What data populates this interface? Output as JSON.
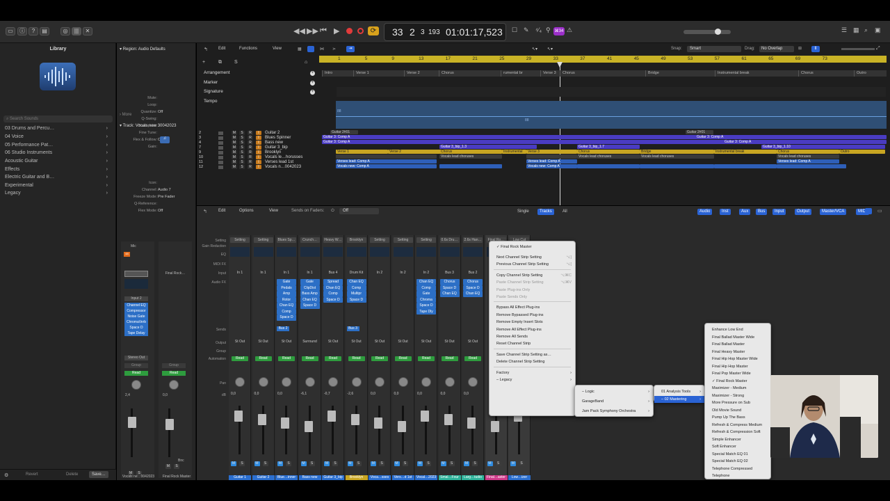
{
  "transport": {
    "bar": "33",
    "beat": "2",
    "div": "3",
    "tick": "193",
    "time": "01:01:17,523",
    "key_badge": "⌘34"
  },
  "library": {
    "title": "Library",
    "search_placeholder": "Search Sounds",
    "categories": [
      "03 Drums and Percu…",
      "04 Voice",
      "05 Performance Pat…",
      "06 Studio Instruments",
      "Acoustic Guitar",
      "Effects",
      "Electric Guitar and B…",
      "Experimental",
      "Legacy"
    ],
    "footer": {
      "revert": "Revert",
      "delete": "Delete",
      "save": "Save…"
    }
  },
  "inspector": {
    "region_header": "Region: Audio Defaults",
    "region_rows": [
      {
        "l": "Mute:",
        "v": ""
      },
      {
        "l": "Loop:",
        "v": ""
      },
      {
        "l": "Quantize:",
        "v": "Off"
      },
      {
        "l": "Q-Swing:",
        "v": ""
      },
      {
        "l": "Transpose:",
        "v": ""
      },
      {
        "l": "Fine Tune:",
        "v": ""
      },
      {
        "l": "Flex & Follow:",
        "v": "Off"
      },
      {
        "l": "Gain:",
        "v": ""
      }
    ],
    "more": "More",
    "track_header": "Track:  Vocals new 30042023",
    "track_rows": [
      {
        "l": "Icon:",
        "v": ""
      },
      {
        "l": "Channel:",
        "v": "Audio 7"
      },
      {
        "l": "Freeze Mode:",
        "v": "Pre Fader"
      },
      {
        "l": "Q-Reference:",
        "v": ""
      },
      {
        "l": "Flex Mode:",
        "v": "Off"
      }
    ],
    "strip1": {
      "mic": "Mic",
      "input": "Input 2",
      "plugins": [
        "Channel EQ",
        "Compressor",
        "Noise Gate",
        "ChromaVerb",
        "Space D",
        "Tape Delay"
      ],
      "output": "Stereo Out",
      "group": "Group",
      "read": "Read",
      "pan": "2,4",
      "vol": "0,0",
      "name": "Vocals ne…0042023"
    },
    "strip2": {
      "setting": "Final Rock…",
      "group": "Group",
      "read": "Read",
      "vol": "0,0",
      "bnc": "Bnc",
      "name": "Final Rock Master"
    }
  },
  "tracks_toolbar": {
    "edit": "Edit",
    "functions": "Functions",
    "view": "View",
    "snap_label": "Snap:",
    "snap": "Smart",
    "drag_label": "Drag:",
    "drag": "No Overlap"
  },
  "global_tracks": [
    "Arrangement",
    "Marker",
    "Signature",
    "Tempo"
  ],
  "ruler": [
    "1",
    "5",
    "9",
    "13",
    "17",
    "21",
    "25",
    "29",
    "33",
    "37",
    "41",
    "45",
    "49",
    "53",
    "57",
    "61",
    "65",
    "69",
    "73"
  ],
  "sections": [
    {
      "t": "Intro"
    },
    {
      "t": "Verse 1"
    },
    {
      "t": "Verse 2"
    },
    {
      "t": "Chorus"
    },
    {
      "t": "rumental br"
    },
    {
      "t": "Verse 3"
    },
    {
      "t": "Chorus"
    },
    {
      "t": "Bridge"
    },
    {
      "t": "Instrumental break"
    },
    {
      "t": "Chorus"
    },
    {
      "t": "Outro"
    }
  ],
  "tempo": {
    "a": "88",
    "b": "88"
  },
  "tracks": [
    {
      "n": "2",
      "name": "Guitar 2"
    },
    {
      "n": "3",
      "name": "Blues Spinner"
    },
    {
      "n": "4",
      "name": "Bass new"
    },
    {
      "n": "7",
      "name": "Guitar 3_bip"
    },
    {
      "n": "9",
      "name": "Brooklyn"
    },
    {
      "n": "10",
      "name": "Vocals le…horusses"
    },
    {
      "n": "11",
      "name": "Verses lead 1st"
    },
    {
      "n": "12",
      "name": "Vocals n…0042023"
    }
  ],
  "region_labels": {
    "g1": "Guitar 2#01",
    "g2": "Guitar 2#01",
    "comp": "Guitar 3: Comp A",
    "bip": "Guitar 3_bip_1.3",
    "bip2": "Guitar 3_bip_1.7",
    "bip3": "Guitar 3_bip_1.10",
    "verse1": "Verse 1",
    "verse2": "Verse 2",
    "chorus": "Chorus",
    "instr": "Instrumental",
    "verse3": "Verse 3",
    "bridge": "Bridge",
    "ibreak": "Instrumental break",
    "outro": "Outro",
    "vlead": "Verses lead: Comp A",
    "vchor": "Vocals lead choruses",
    "vnew": "Vocals new: Comp A"
  },
  "mixer_toolbar": {
    "edit": "Edit",
    "options": "Options",
    "view": "View",
    "sends": "Sends on Faders:",
    "off": "Off",
    "single": "Single",
    "tracks": "Tracks",
    "all": "All",
    "filters": [
      "Audio",
      "Inst",
      "Aux",
      "Bus",
      "Input",
      "Output",
      "Master/VCA",
      "MIDI"
    ]
  },
  "mixer_rows": [
    "Setting",
    "Gain Reduction",
    "EQ",
    "MIDI FX",
    "Input",
    "Audio FX",
    "Sends",
    "Output",
    "Group",
    "Automation",
    "Pan",
    "dB"
  ],
  "strips": [
    {
      "setting": "Setting",
      "input": "In 1",
      "fx": [],
      "out": "St Out",
      "pan": "0,0",
      "color": "#2b6fd0",
      "name": "Guitar 1"
    },
    {
      "setting": "Setting",
      "input": "In 1",
      "fx": [],
      "out": "St Out",
      "pan": "0,0",
      "color": "#2b6fd0",
      "name": "Guitar 2"
    },
    {
      "setting": "Blues Sp…",
      "input": "In 1",
      "fx": [
        "Gate",
        "Pedals",
        "Amp",
        "Rotor",
        "Chan EQ",
        "Comp",
        "Space D"
      ],
      "send": "Bus 2",
      "out": "St Out",
      "pan": "0,0",
      "color": "#2b6fd0",
      "name": "Blue…inner"
    },
    {
      "setting": "Crunch…",
      "input": "In 1",
      "fx": [
        "Gate",
        "ClipDist",
        "Bass Amp",
        "Chan EQ",
        "Space D"
      ],
      "out": "Surround",
      "pan": "-6,1",
      "color": "#2b6fd0",
      "name": "Bass new"
    },
    {
      "setting": "Heavy W…",
      "input": "Bus 4",
      "fx": [
        "Spread",
        "Chan EQ",
        "Comp",
        "Space D"
      ],
      "out": "St Out",
      "pan": "-0,7",
      "color": "#2b6fd0",
      "name": "Guitar 3_bip"
    },
    {
      "setting": "Brooklyn",
      "input": "Drum Kit",
      "fx": [
        "Chan EQ",
        "Comp",
        "Multipr",
        "Space D"
      ],
      "send": "Bus 3",
      "out": "St Out",
      "pan": "-2,6",
      "color": "#c8a522",
      "name": "Brooklyn"
    },
    {
      "setting": "Setting",
      "input": "In 2",
      "fx": [],
      "out": "St Out",
      "pan": "0,0",
      "color": "#2b6fd0",
      "name": "Voca…sses"
    },
    {
      "setting": "Setting",
      "input": "In 2",
      "fx": [],
      "out": "St Out",
      "pan": "0,0",
      "color": "#2b6fd0",
      "name": "Vers…d 1st"
    },
    {
      "setting": "Setting",
      "input": "In 2",
      "fx": [
        "Chan EQ",
        "Comp",
        "Gate",
        "Chroma",
        "Space D",
        "Tape Dly"
      ],
      "out": "St Out",
      "pan": "0,0",
      "color": "#2b6fd0",
      "name": "Vocal…2023"
    },
    {
      "setting": "0.6s Dru…",
      "input": "Bus 3",
      "fx": [
        "Chorus",
        "Space D",
        "Chan EQ"
      ],
      "out": "St Out",
      "pan": "0,0",
      "color": "#2eb39a",
      "name": "Smal…Four"
    },
    {
      "setting": "2.6s Han…",
      "input": "Bus 2",
      "fx": [
        "Chorus",
        "Space D",
        "Chan EQ"
      ],
      "out": "St Out",
      "pan": "0,0",
      "color": "#2eb39a",
      "name": "Larg…tudio"
    },
    {
      "setting": "Final Ro…",
      "input": "",
      "fx": [],
      "out": "",
      "pan": "",
      "color": "#d03a8a",
      "name": "Final…aster"
    },
    {
      "setting": "Low Cut",
      "input": "",
      "fx": [],
      "out": "",
      "pan": "",
      "color": "#2b6fd0",
      "name": "Low…izer"
    }
  ],
  "strip_read": "Read",
  "menu1": {
    "checked": "Final Rock Master",
    "items": [
      "Next Channel Strip Setting",
      "Previous Channel Strip Setting",
      "Copy Channel Strip Setting",
      "Paste Channel Strip Setting",
      "Paste Plug-ins Only",
      "Paste Sends Only",
      "Bypass All Effect Plug-ins",
      "Remove Bypassed Plug-ins",
      "Remove Empty Insert Slots",
      "Remove All Effect Plug-ins",
      "Remove All Sends",
      "Reset Channel Strip",
      "Save Channel Strip Setting as…",
      "Delete Channel Strip Setting",
      "Factory",
      "Legacy"
    ],
    "shortcuts": [
      "⌥]",
      "⌥[",
      "⌥⌘C",
      "⌥⌘V",
      "",
      ""
    ]
  },
  "menu2": {
    "items": [
      "Logic",
      "GarageBand",
      "Jam Pack Symphony Orchestra"
    ]
  },
  "menu3": {
    "items": [
      "01 Analysis Tools",
      "02 Mastering"
    ]
  },
  "menu4": {
    "items": [
      "Enhance Low End",
      "Final Ballad Master Wide",
      "Final Ballad Master",
      "Final Heavy Master",
      "Final Hip Hop Master Wide",
      "Final Hip Hop Master",
      "Final Pop Master Wide",
      "Final Rock Master",
      "Maximizer - Medium",
      "Maximizer - Strong",
      "More Pressure on Sub",
      "Old Movie Sound",
      "Pump Up The Bass",
      "Refresh & Compress Medium",
      "Refresh & Compression Soft",
      "Simple Enhancer",
      "Soft Enhancer",
      "Special Match EQ 01",
      "Special Match EQ 02",
      "Telephone Compressed",
      "Telephone"
    ],
    "checked_index": 7
  }
}
